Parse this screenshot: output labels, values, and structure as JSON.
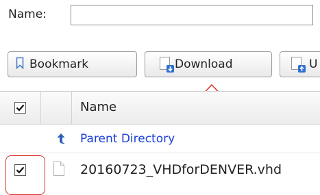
{
  "form": {
    "name_label": "Name:",
    "name_value": ""
  },
  "toolbar": {
    "bookmark_label": "Bookmark",
    "download_label": "Download",
    "upload_label": "U"
  },
  "table": {
    "header": {
      "name": "Name",
      "select_all_checked": true
    },
    "rows": [
      {
        "type": "parent",
        "label": "Parent Directory"
      },
      {
        "type": "file",
        "name": "20160723_VHDforDENVER.vhd",
        "checked": true
      }
    ]
  },
  "colors": {
    "annotation": "#d9332b",
    "link": "#1a3fd6",
    "icon_accent": "#2f6fd0"
  },
  "icons": {
    "bookmark": "bookmark-icon",
    "download": "download-file-icon",
    "upload": "upload-file-icon",
    "parent": "up-arrow-icon",
    "file": "file-icon"
  }
}
